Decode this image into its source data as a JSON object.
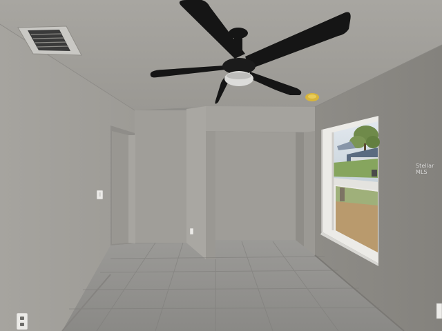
{
  "photo": {
    "watermark_text": "Stellar MLS",
    "palette": {
      "ceiling": "#9e9c97",
      "left_wall": "#a3a19c",
      "right_wall": "#8d8b86",
      "back_wall": "#a09e99",
      "floor": "#8f8e8b",
      "fan_black": "#151515",
      "fan_light": "#d8d8d6",
      "window_frame": "#ecebe7",
      "sky": "#d4dde4",
      "grass": "#86a55e"
    },
    "objects": [
      "ceiling-fan",
      "ceiling-vent",
      "window",
      "doorway",
      "closet-alcove",
      "smoke-detector",
      "outlets",
      "light-switch",
      "tile-floor"
    ]
  }
}
